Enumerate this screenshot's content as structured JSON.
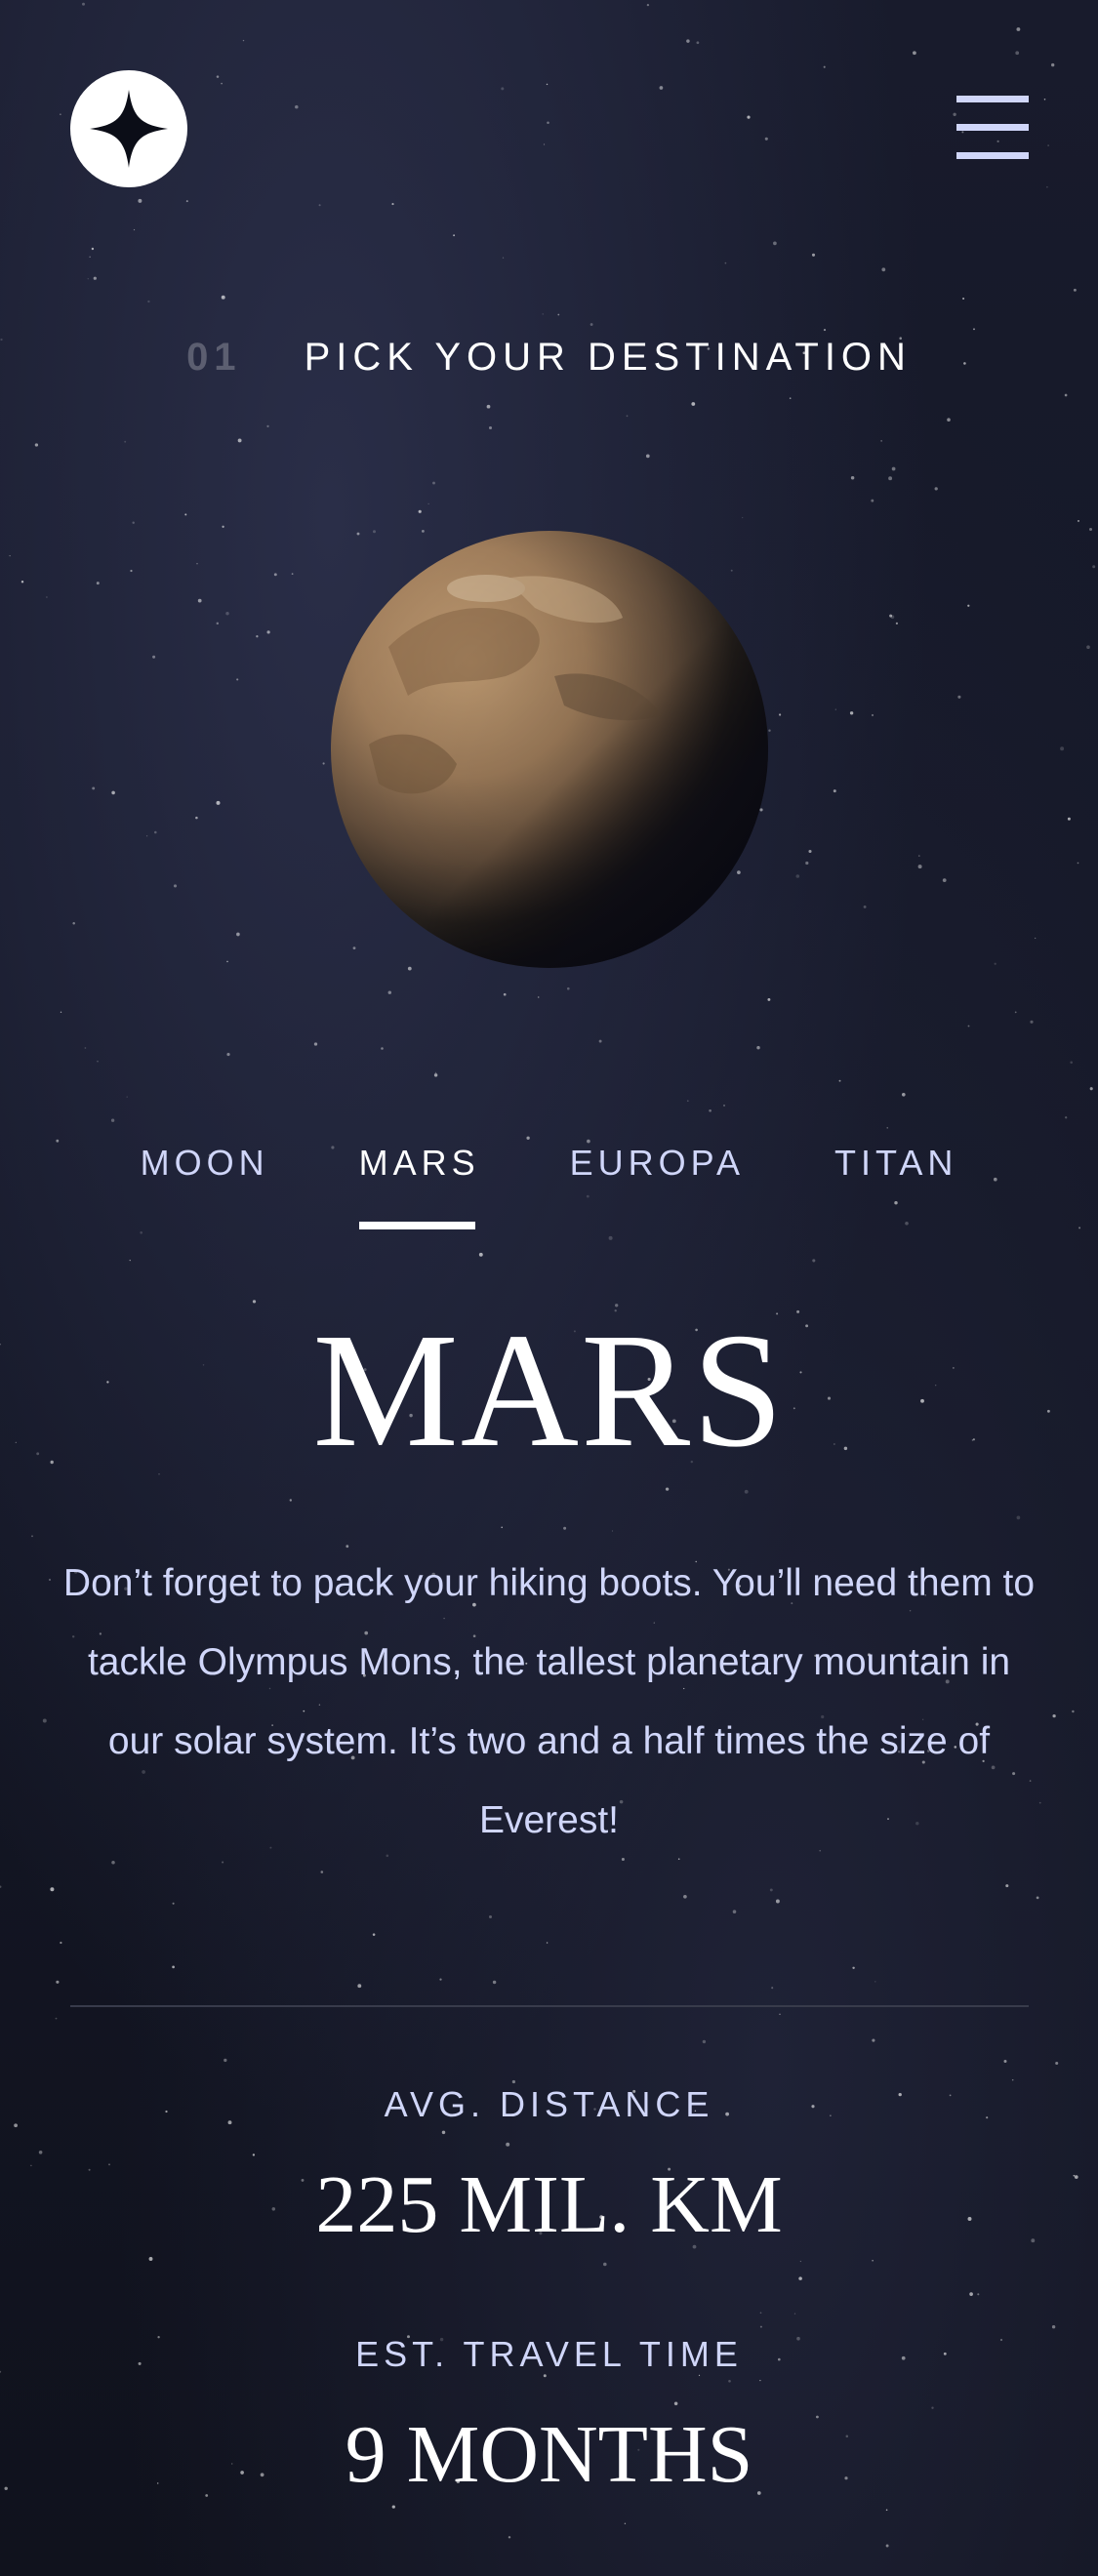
{
  "header": {
    "logo_icon": "star-logo-icon",
    "menu_icon": "hamburger-menu-icon"
  },
  "page": {
    "heading_number": "01",
    "heading_text": "PICK YOUR DESTINATION"
  },
  "planet_image": {
    "icon": "mars-planet-image"
  },
  "tabs": [
    {
      "label": "MOON",
      "active": false
    },
    {
      "label": "MARS",
      "active": true
    },
    {
      "label": "EUROPA",
      "active": false
    },
    {
      "label": "TITAN",
      "active": false
    }
  ],
  "destination": {
    "name": "MARS",
    "description": "Don’t forget to pack your hiking boots. You’ll need them to tackle Olympus Mons, the tallest planetary mountain in our solar system. It’s two and a half times the size of Everest!"
  },
  "stats": {
    "distance_label": "AVG. DISTANCE",
    "distance_value": "225 MIL. KM",
    "travel_label": "EST. TRAVEL TIME",
    "travel_value": "9 MONTHS"
  },
  "colors": {
    "background": "#141726",
    "accent": "#d0d6f9",
    "text": "#ffffff",
    "divider": "#383b4b"
  }
}
